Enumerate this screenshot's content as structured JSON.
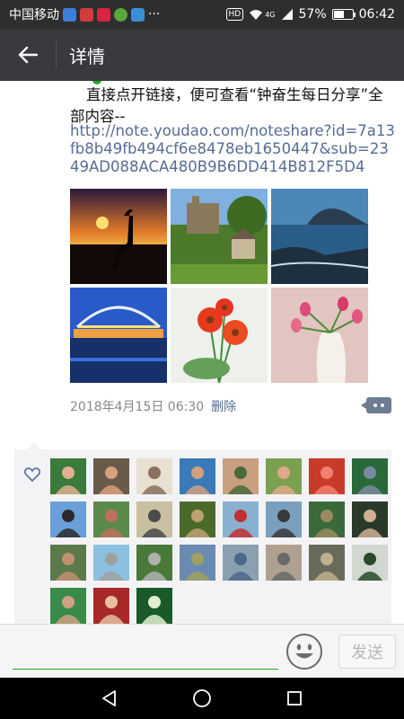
{
  "status_bar": {
    "carrier": "中国移动",
    "network": "4G",
    "hd": "HD",
    "battery_text": "57%",
    "battery_level": 0.57,
    "time": "06:42"
  },
  "header": {
    "title": "详情"
  },
  "post": {
    "text": "直接点开链接，便可查看“钟奋生每日分享”全部内容--",
    "link": "http://note.youdao.com/noteshare?id=7a13fb8b49fb494cf6e8478eb1650447&sub=2349AD088ACA480B9B6DD414B812F5D4",
    "images": [
      {
        "name": "crane-sunset-photo"
      },
      {
        "name": "castle-garden-photo"
      },
      {
        "name": "rocky-coast-photo"
      },
      {
        "name": "bridge-night-photo"
      },
      {
        "name": "red-gerbera-photo"
      },
      {
        "name": "tulips-vase-photo"
      }
    ],
    "date": "2018年4月15日 06:30",
    "delete_label": "删除"
  },
  "likes": {
    "count_avatars": 27
  },
  "composer": {
    "placeholder": "",
    "send_label": "发送"
  },
  "icons": {
    "back": "arrow-left-icon",
    "like": "heart-icon",
    "comment": "comment-dots-icon",
    "emoji": "smiley-icon",
    "nav_back": "triangle-back-icon",
    "nav_home": "circle-home-icon",
    "nav_recent": "square-recent-icon"
  },
  "colors": {
    "link": "#576b95",
    "accent": "#1aad19",
    "header_bg": "#393a3f"
  }
}
